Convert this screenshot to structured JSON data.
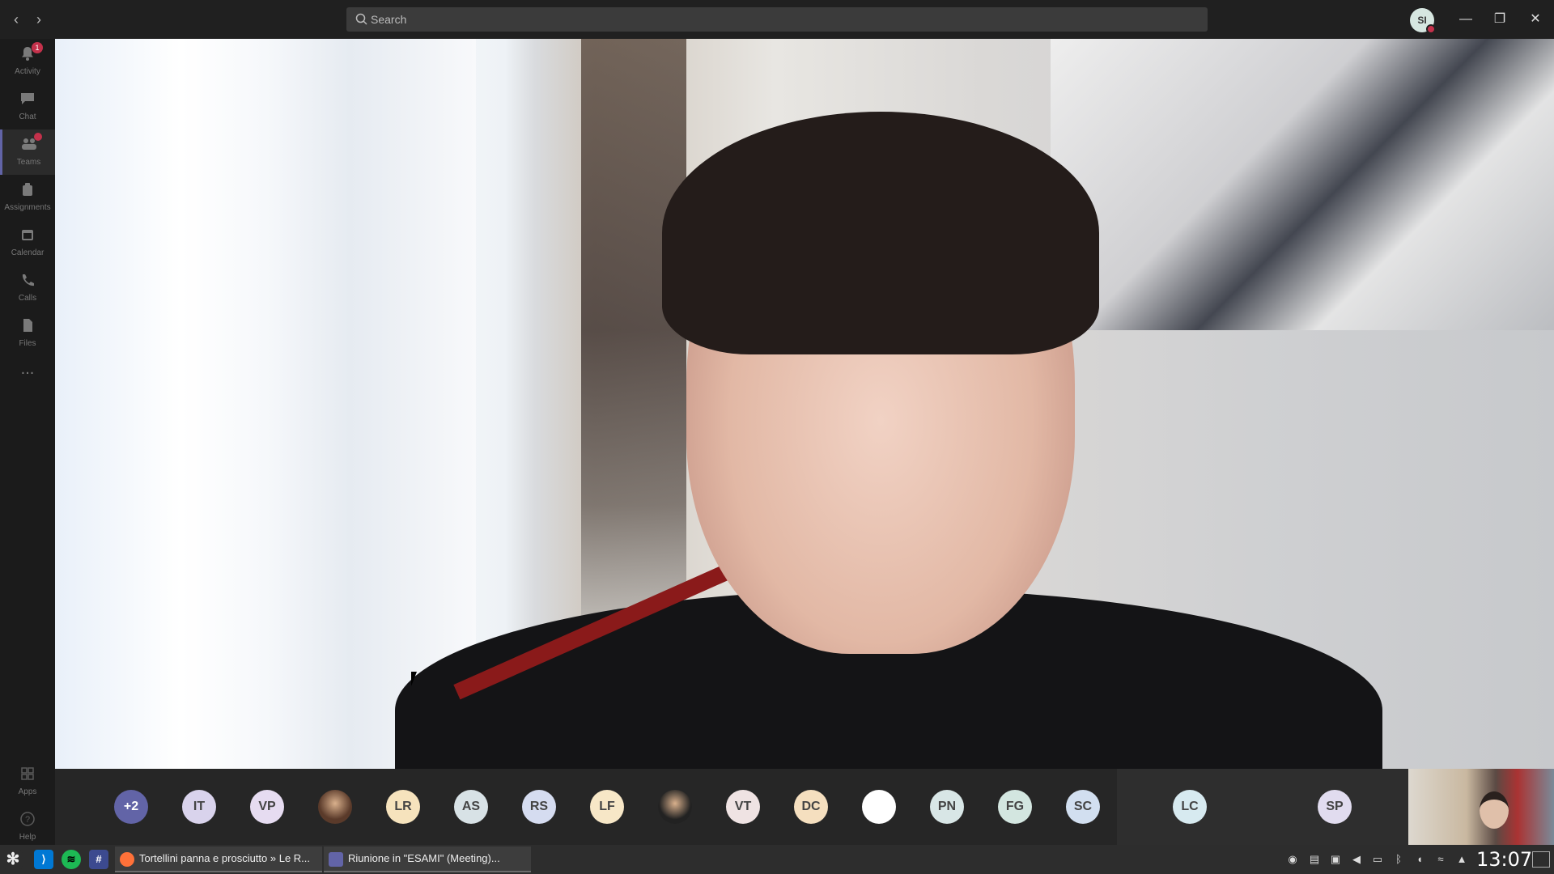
{
  "titlebar": {
    "search_placeholder": "Search",
    "user_initials": "SI"
  },
  "rail": {
    "items": [
      {
        "label": "Activity",
        "badge": "1"
      },
      {
        "label": "Chat"
      },
      {
        "label": "Teams",
        "badge": ""
      },
      {
        "label": "Assignments"
      },
      {
        "label": "Calendar"
      },
      {
        "label": "Calls"
      },
      {
        "label": "Files"
      }
    ],
    "more_label": "...",
    "apps_label": "Apps",
    "help_label": "Help"
  },
  "participants": [
    {
      "initials": "+2",
      "color": "#6264a7",
      "text_color": "#ffffff"
    },
    {
      "initials": "IT",
      "color": "#d9d3ec"
    },
    {
      "initials": "VP",
      "color": "#e6dcf1"
    },
    {
      "initials": "",
      "photo": true,
      "color": "#5a3a2a"
    },
    {
      "initials": "LR",
      "color": "#f6e3bd"
    },
    {
      "initials": "AS",
      "color": "#d8e2e6"
    },
    {
      "initials": "RS",
      "color": "#d5dcf0"
    },
    {
      "initials": "LF",
      "color": "#f7e7c7"
    },
    {
      "initials": "",
      "photo": true,
      "color": "#222222"
    },
    {
      "initials": "VT",
      "color": "#efe3e3"
    },
    {
      "initials": "DC",
      "color": "#f5dfbf"
    },
    {
      "initials": "",
      "color": "#ffffff"
    },
    {
      "initials": "PN",
      "color": "#d8e6e6"
    },
    {
      "initials": "FG",
      "color": "#d3e6e0"
    },
    {
      "initials": "SC",
      "color": "#d2dff0"
    },
    {
      "initials": "LC",
      "color": "#d7eaf0"
    },
    {
      "initials": "SP",
      "color": "#e1dcef"
    }
  ],
  "taskbar": {
    "tasks": [
      {
        "label": "Tortellini panna e prosciutto » Le R..."
      },
      {
        "label": "Riunione in \"ESAMI\" (Meeting)..."
      }
    ],
    "clock": "13:07"
  },
  "colors": {
    "accent": "#6264a7",
    "badge": "#c4314b",
    "spotify": "#1db954",
    "vscode": "#0078d4"
  }
}
